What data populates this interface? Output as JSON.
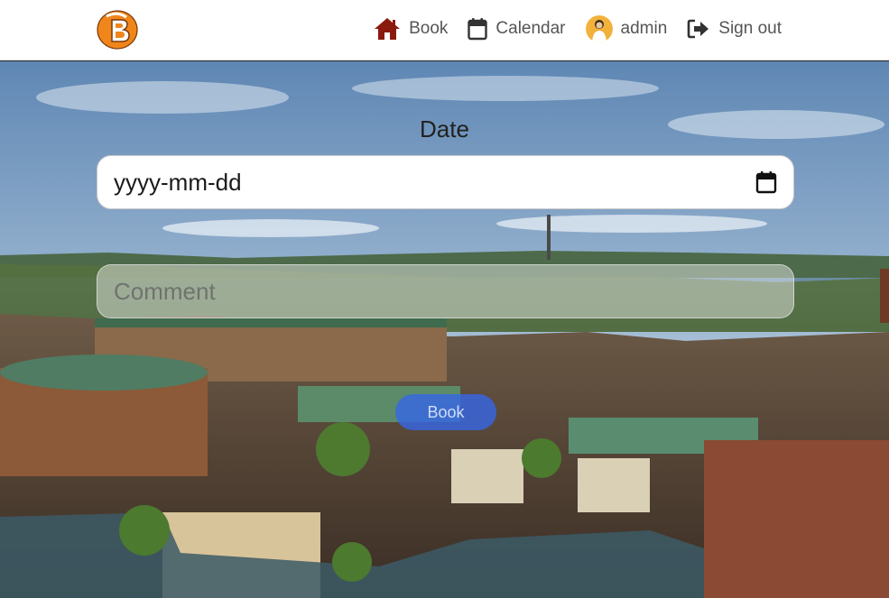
{
  "nav": {
    "logo_letter": "B",
    "items": [
      {
        "label": "Book",
        "icon": "home-icon"
      },
      {
        "label": "Calendar",
        "icon": "calendar-icon"
      },
      {
        "label": "admin",
        "icon": "avatar"
      },
      {
        "label": "Sign out",
        "icon": "sign-out-icon"
      }
    ]
  },
  "form": {
    "date_label": "Date",
    "date_value": "yyyy-mm-dd",
    "comment_placeholder": "Comment",
    "submit_label": "Book"
  },
  "colors": {
    "home_icon": "#8b1a0e",
    "nav_text": "#555555",
    "button": "#3466eb",
    "logo_orange": "#f0861a"
  }
}
